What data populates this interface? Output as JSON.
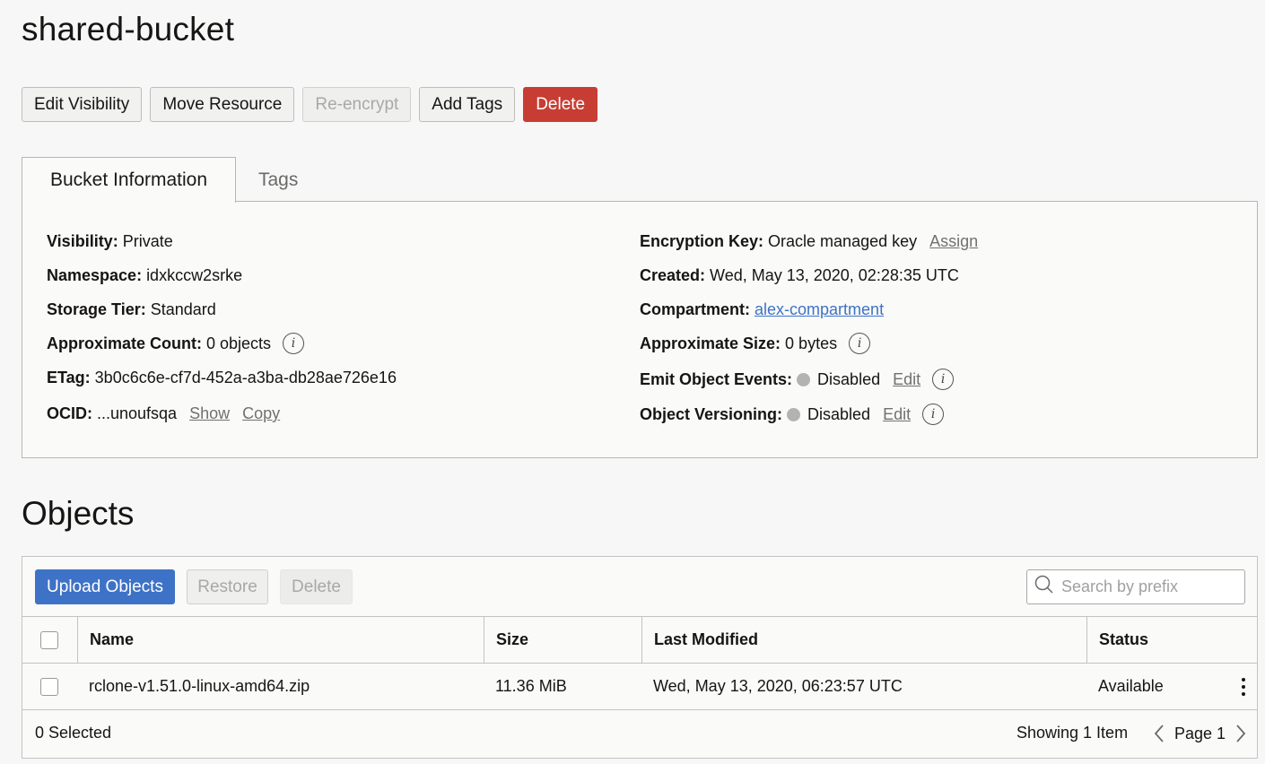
{
  "page": {
    "title": "shared-bucket"
  },
  "actions": {
    "edit_visibility": "Edit Visibility",
    "move_resource": "Move Resource",
    "re_encrypt": "Re-encrypt",
    "add_tags": "Add Tags",
    "delete": "Delete"
  },
  "tabs": {
    "bucket_information": "Bucket Information",
    "tags": "Tags"
  },
  "info": {
    "visibility": {
      "label": "Visibility:",
      "value": "Private"
    },
    "namespace": {
      "label": "Namespace:",
      "value": "idxkccw2srke"
    },
    "storage_tier": {
      "label": "Storage Tier:",
      "value": "Standard"
    },
    "approx_count": {
      "label": "Approximate Count:",
      "value": "0 objects"
    },
    "etag": {
      "label": "ETag:",
      "value": "3b0c6c6e-cf7d-452a-a3ba-db28ae726e16"
    },
    "ocid": {
      "label": "OCID:",
      "value": "...unoufsqa",
      "show": "Show",
      "copy": "Copy"
    },
    "encryption_key": {
      "label": "Encryption Key:",
      "value": "Oracle managed key",
      "assign": "Assign"
    },
    "created": {
      "label": "Created:",
      "value": "Wed, May 13, 2020, 02:28:35 UTC"
    },
    "compartment": {
      "label": "Compartment:",
      "value": "alex-compartment"
    },
    "approx_size": {
      "label": "Approximate Size:",
      "value": "0 bytes"
    },
    "emit_events": {
      "label": "Emit Object Events:",
      "value": "Disabled",
      "edit": "Edit"
    },
    "versioning": {
      "label": "Object Versioning:",
      "value": "Disabled",
      "edit": "Edit"
    },
    "info_glyph": "i"
  },
  "objects": {
    "title": "Objects",
    "upload": "Upload Objects",
    "restore": "Restore",
    "delete": "Delete",
    "search_placeholder": "Search by prefix",
    "columns": {
      "name": "Name",
      "size": "Size",
      "last_modified": "Last Modified",
      "status": "Status"
    },
    "rows": [
      {
        "name": "rclone-v1.51.0-linux-amd64.zip",
        "size": "11.36 MiB",
        "last_modified": "Wed, May 13, 2020, 06:23:57 UTC",
        "status": "Available"
      }
    ],
    "selected": "0 Selected",
    "showing": "Showing 1 Item",
    "page": "Page 1"
  },
  "icons": {
    "search": "search-icon",
    "info": "info-icon",
    "kebab": "more-actions-icon",
    "prev": "chevron-left-icon",
    "next": "chevron-right-icon"
  },
  "colors": {
    "primary": "#3e72c6",
    "danger": "#c83d33",
    "link": "#3e72c6",
    "muted_link": "#717170",
    "disabled_dot": "#b3b3b2"
  }
}
